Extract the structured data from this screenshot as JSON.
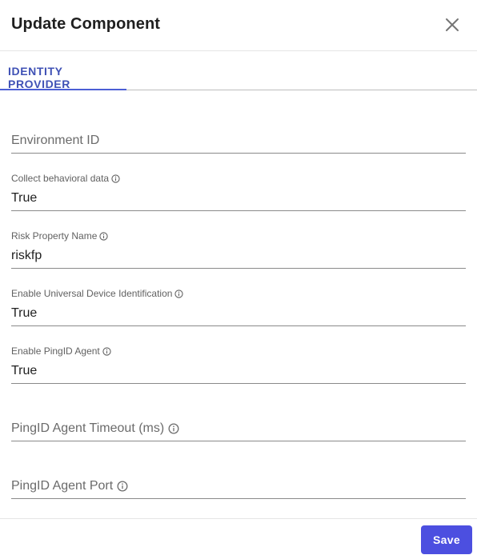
{
  "dialog": {
    "title": "Update Component",
    "close_icon": "close-icon"
  },
  "tabs": [
    {
      "label": "IDENTITY PROVIDER",
      "active": true
    }
  ],
  "fields": {
    "environment_id": {
      "label": "Environment ID",
      "value": "",
      "has_info": false
    },
    "collect_behavioral_data": {
      "label": "Collect behavioral data",
      "value": "True",
      "has_info": true
    },
    "risk_property_name": {
      "label": "Risk Property Name",
      "value": "riskfp",
      "has_info": true
    },
    "enable_universal_device_identification": {
      "label": "Enable Universal Device Identification",
      "value": "True",
      "has_info": true
    },
    "enable_pingid_agent": {
      "label": "Enable PingID Agent",
      "value": "True",
      "has_info": true
    },
    "pingid_agent_timeout": {
      "label": "PingID Agent Timeout (ms)",
      "value": "",
      "has_info": true
    },
    "pingid_agent_port": {
      "label": "PingID Agent Port",
      "value": "",
      "has_info": true
    }
  },
  "footer": {
    "save_label": "Save"
  },
  "colors": {
    "accent": "#4c4fe0",
    "tab_active": "#3f51b5",
    "underline": "#8a8a8a"
  }
}
